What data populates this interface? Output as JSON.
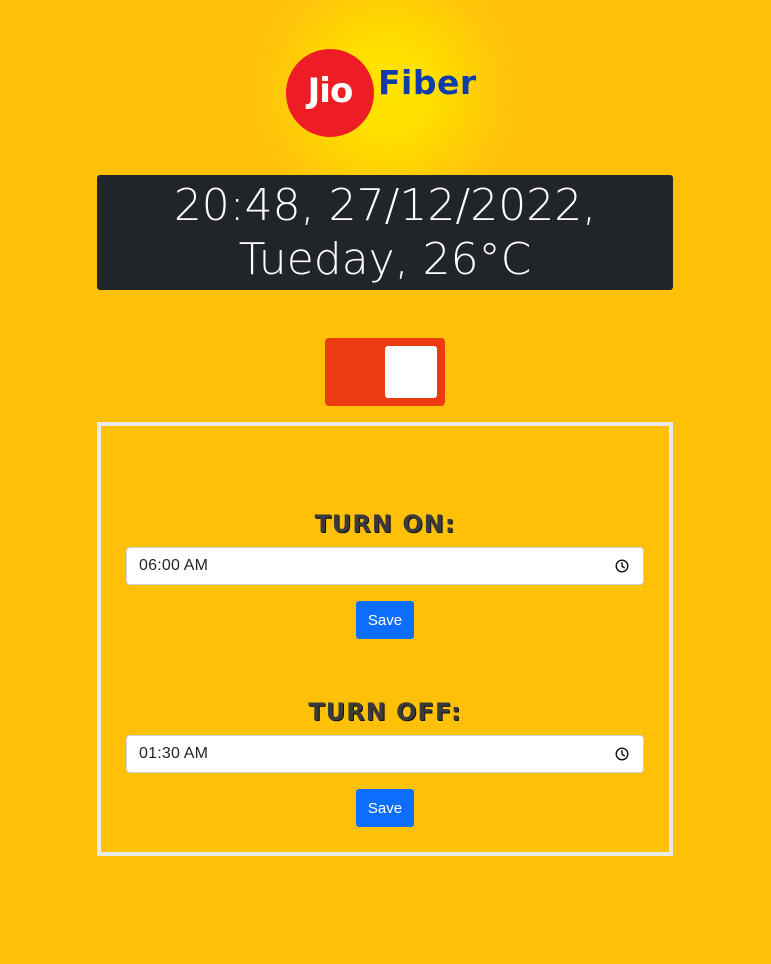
{
  "logo": {
    "jio": "Jio",
    "fiber": "Fiber",
    "colors": {
      "circle": "#ee1c25",
      "fiber_text": "#0f3ca8"
    }
  },
  "status": {
    "datetime_weather": "20:48, 27/12/2022, Tueday, 26°C"
  },
  "power_switch": {
    "state": "on",
    "track_color": "#ec3a11"
  },
  "schedule": {
    "turn_on": {
      "heading": "TURN ON:",
      "time_value": "06:00  AM",
      "save_label": "Save",
      "icon": "clock-icon"
    },
    "turn_off": {
      "heading": "TURN OFF:",
      "time_value": "01:30  AM",
      "save_label": "Save",
      "icon": "clock-icon"
    }
  },
  "colors": {
    "page_background": "#ffc107",
    "clock_panel": "#212529",
    "save_button": "#0d6efd",
    "frame_border": "#e9e9e9"
  }
}
